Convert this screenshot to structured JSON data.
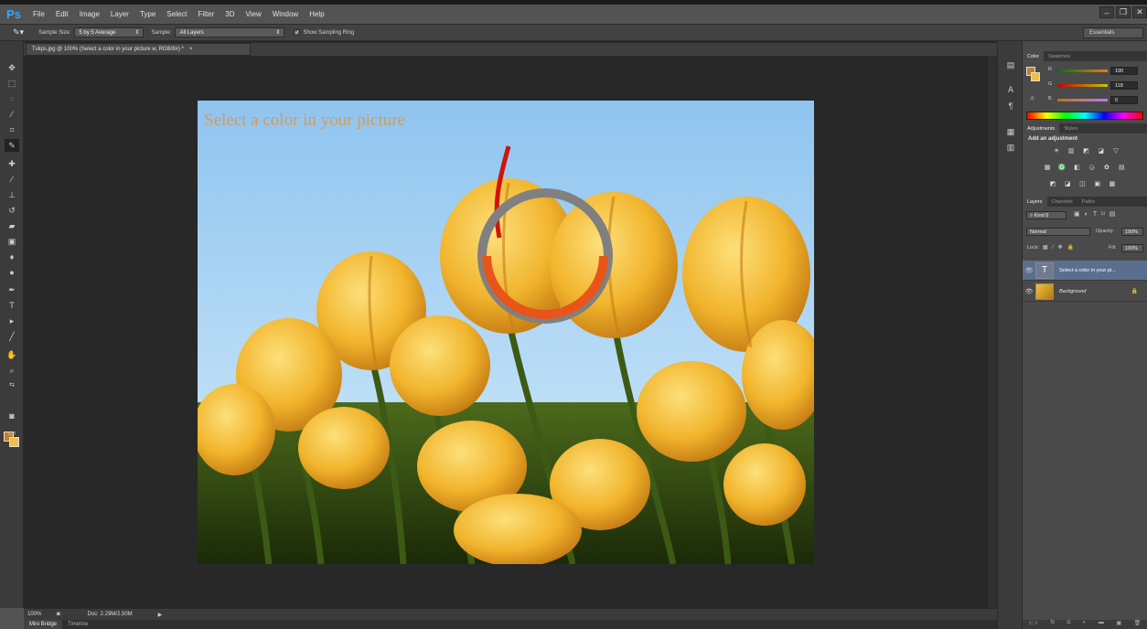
{
  "app": {
    "logo": "Ps"
  },
  "menu": [
    "File",
    "Edit",
    "Image",
    "Layer",
    "Type",
    "Select",
    "Filter",
    "3D",
    "View",
    "Window",
    "Help"
  ],
  "window_controls": [
    "–",
    "❐",
    "✕"
  ],
  "options": {
    "sample_size_label": "Sample Size:",
    "sample_size_value": "5 by 5 Average",
    "sample_label": "Sample:",
    "sample_value": "All Layers",
    "show_sampling_ring": "Show Sampling Ring",
    "workspace": "Essentials"
  },
  "document": {
    "tab_title": "Tulips.jpg @ 100% (Select a color in your picture  w, RGB/8#) *",
    "close": "×",
    "overlay_text": "Select a color in your picture"
  },
  "status": {
    "zoom": "100%",
    "doc_info": "Doc: 2.29M/2.50M"
  },
  "bottom_tabs": [
    "Mini Bridge",
    "Timeline"
  ],
  "color_panel": {
    "tabs": [
      "Color",
      "Swatches"
    ],
    "r_label": "R",
    "r_value": "190",
    "g_label": "G",
    "g_value": "118",
    "b_label": "B",
    "b_value": "0",
    "foreground": "#c47e2c",
    "background": "#f0c040"
  },
  "adjustments_panel": {
    "tabs": [
      "Adjustments",
      "Styles"
    ],
    "heading": "Add an adjustment"
  },
  "layers_panel": {
    "tabs": [
      "Layers",
      "Channels",
      "Paths"
    ],
    "filter_label": "Kind",
    "blend_mode": "Normal",
    "opacity_label": "Opacity:",
    "opacity_value": "100%",
    "lock_label": "Lock:",
    "fill_label": "Fill:",
    "fill_value": "100%",
    "layers": [
      {
        "name": "Select a color in your pi...",
        "type": "text",
        "selected": true
      },
      {
        "name": "Background",
        "type": "image",
        "selected": false
      }
    ]
  }
}
